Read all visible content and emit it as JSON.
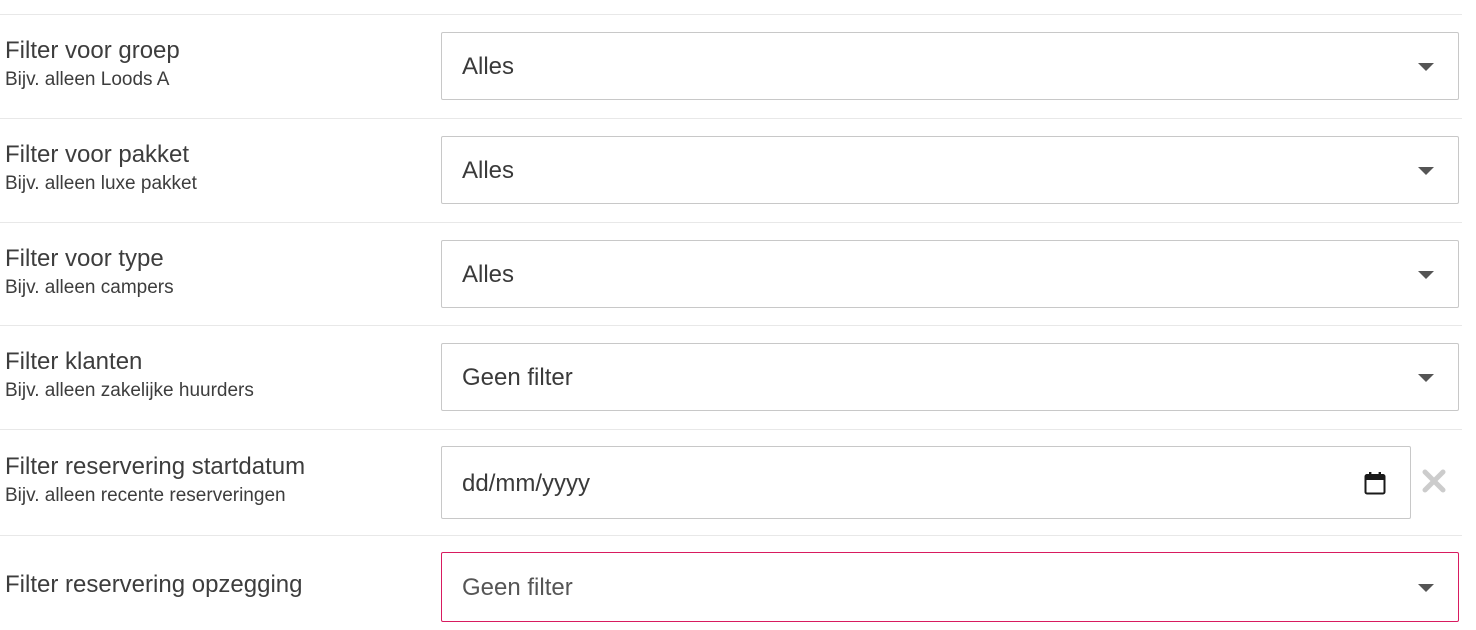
{
  "filters": [
    {
      "title": "Filter voor groep",
      "hint": "Bijv. alleen Loods A",
      "control_type": "select",
      "value": "Alles"
    },
    {
      "title": "Filter voor pakket",
      "hint": "Bijv. alleen luxe pakket",
      "control_type": "select",
      "value": "Alles"
    },
    {
      "title": "Filter voor type",
      "hint": "Bijv. alleen campers",
      "control_type": "select",
      "value": "Alles"
    },
    {
      "title": "Filter klanten",
      "hint": "Bijv. alleen zakelijke huurders",
      "control_type": "select",
      "value": "Geen filter"
    },
    {
      "title": "Filter reservering startdatum",
      "hint": "Bijv. alleen recente reserveringen",
      "control_type": "date",
      "placeholder": "dd/mm/yyyy",
      "icon": "calendar-icon",
      "clear_icon": "close-icon"
    },
    {
      "title": "Filter reservering opzegging",
      "hint": "",
      "control_type": "select",
      "value": "Geen filter",
      "state": "invalid"
    }
  ],
  "colors": {
    "border": "#c8c8c8",
    "divider": "#e8e8e8",
    "invalid_border": "#d81b60",
    "text": "#3a3a3a",
    "clear_icon": "#cccccc"
  }
}
